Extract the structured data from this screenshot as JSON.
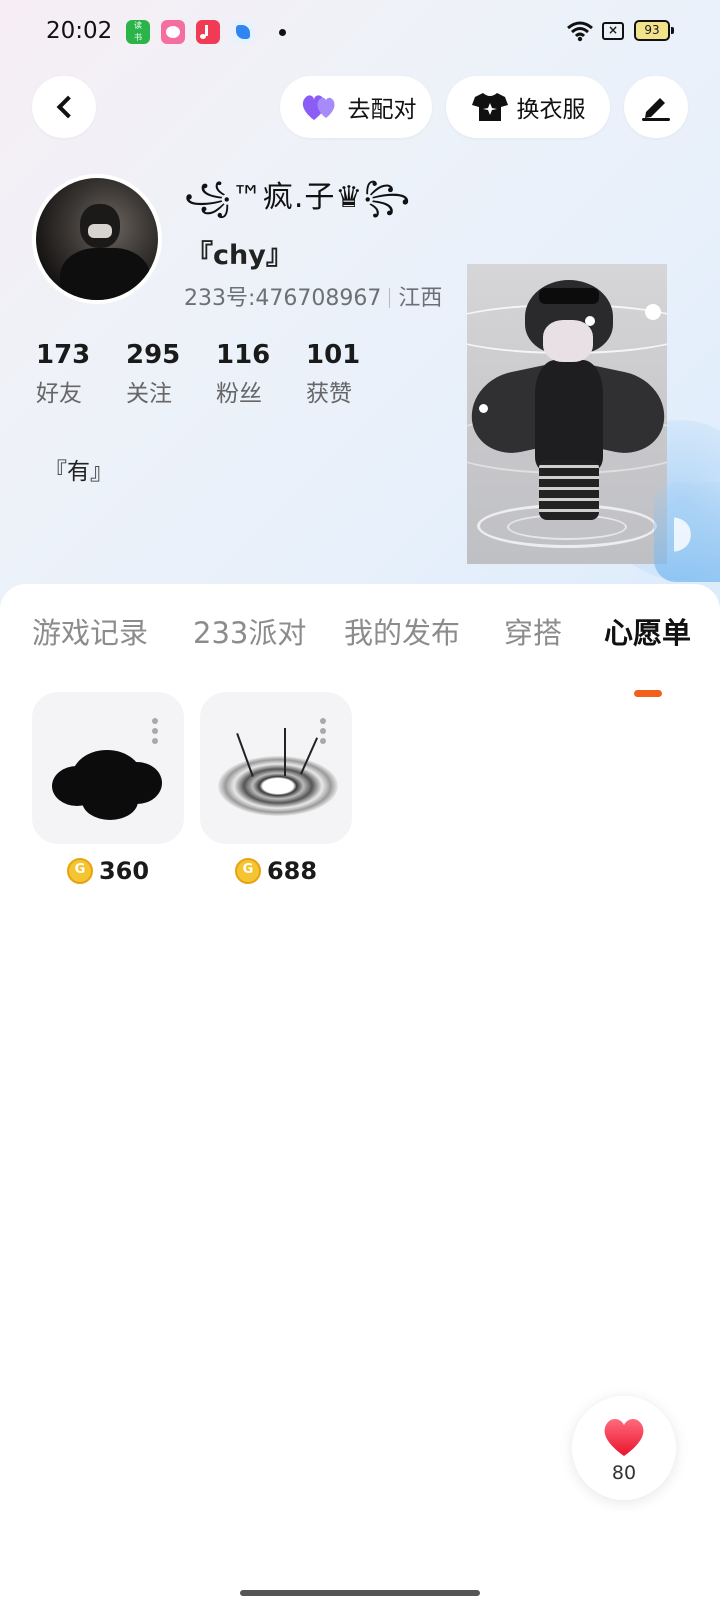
{
  "status_bar": {
    "time": "20:02",
    "app1_label": "读好\n读书",
    "battery": "93"
  },
  "nav": {
    "back_icon": "chevron-left-icon",
    "match_label": "去配对",
    "match_icon": "double-heart-icon",
    "dressup_label": "换衣服",
    "dressup_icon": "tshirt-icon",
    "edit_icon": "pen-icon"
  },
  "profile": {
    "nickname": "꧁™疯.子♛꧂",
    "realname": "『chy』",
    "id_text": "233号:476708967",
    "region": "江西",
    "bio": "『有』",
    "stats": [
      {
        "value": "173",
        "label": "好友"
      },
      {
        "value": "295",
        "label": "关注"
      },
      {
        "value": "116",
        "label": "粉丝"
      },
      {
        "value": "101",
        "label": "获赞"
      }
    ]
  },
  "tabs": [
    {
      "label": "游戏记录",
      "active": false
    },
    {
      "label": "233派对",
      "active": false
    },
    {
      "label": "我的发布",
      "active": false
    },
    {
      "label": "穿搭",
      "active": false
    },
    {
      "label": "心愿单",
      "active": true
    }
  ],
  "wishlist": [
    {
      "price": "360",
      "icon": "black-flower-accessory"
    },
    {
      "price": "688",
      "icon": "ink-disc-effect"
    }
  ],
  "like_fab": {
    "count": "80",
    "icon": "heart-icon",
    "color": "#f0314c"
  },
  "colors": {
    "accent": "#f2601d",
    "match_purple": "#8b5cf6",
    "coin": "#f5c431"
  }
}
